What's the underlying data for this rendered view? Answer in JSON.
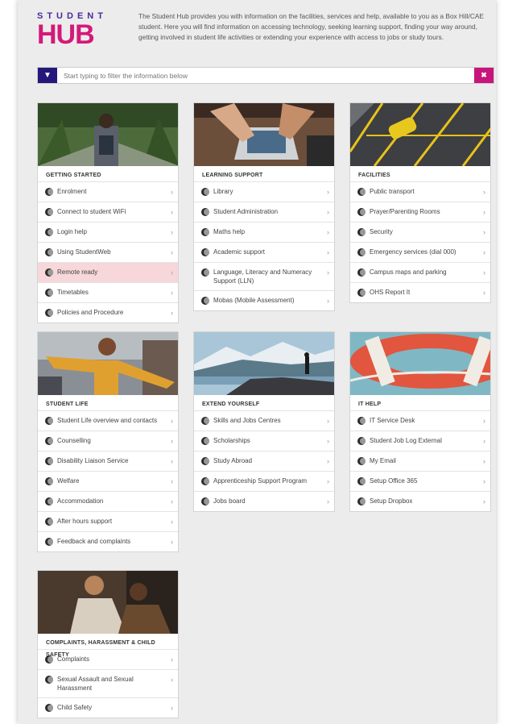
{
  "brand": {
    "top": "STUDENT",
    "hub": "HUB"
  },
  "intro": "The Student Hub provides you with information on the facilities, services and help, available to you as a Box Hill/CAE student. Here you will find information on accessing technology, seeking learning support, finding your way around, getting involved in student life activities or extending your experience with access to jobs or study tours.",
  "filter": {
    "placeholder": "Start typing to filter the information below"
  },
  "cards": [
    {
      "title": "GETTING STARTED",
      "items": [
        "Enrolment",
        "Connect to student WiFi",
        "Login help",
        "Using StudentWeb",
        "Remote ready",
        "Timetables",
        "Policies and Procedure"
      ]
    },
    {
      "title": "LEARNING SUPPORT",
      "items": [
        "Library",
        "Student Administration",
        "Maths help",
        "Academic support",
        "Language, Literacy and Numeracy Support (LLN)",
        "Mobas (Mobile Assessment)"
      ]
    },
    {
      "title": "FACILITIES",
      "items": [
        "Public transport",
        "Prayer/Parenting Rooms",
        "Security",
        "Emergency services (dial 000)",
        "Campus maps and parking",
        "OHS Report It"
      ]
    },
    {
      "title": "STUDENT LIFE",
      "items": [
        "Student Life overview and contacts",
        "Counselling",
        "Disability Liaison Service",
        "Welfare",
        "Accommodation",
        "After hours support",
        "Feedback and complaints"
      ]
    },
    {
      "title": "EXTEND YOURSELF",
      "items": [
        "Skills and Jobs Centres",
        "Scholarships",
        "Study Abroad",
        "Apprenticeship Support Program",
        "Jobs board"
      ]
    },
    {
      "title": "IT HELP",
      "items": [
        "IT Service Desk",
        "Student Job Log External",
        "My Email",
        "Setup Office 365",
        "Setup Dropbox"
      ]
    },
    {
      "title": "COMPLAINTS, HARASSMENT & CHILD SAFETY",
      "items": [
        "Complaints",
        "Sexual Assault and Sexual Harassment",
        "Child Safety"
      ]
    }
  ]
}
